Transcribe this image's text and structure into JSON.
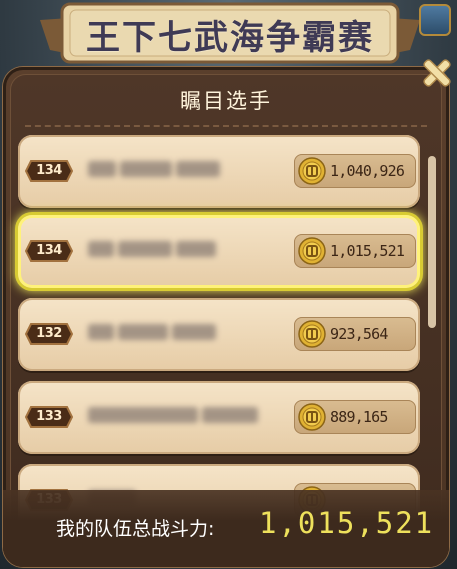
{
  "event_title": "王下七武海争霸赛",
  "panel": {
    "title": "瞩目选手"
  },
  "players": [
    {
      "level": "134",
      "power": "1,040,926",
      "selected": false,
      "name_blocks": 3
    },
    {
      "level": "134",
      "power": "1,015,521",
      "selected": true,
      "name_blocks": 3
    },
    {
      "level": "132",
      "power": "923,564",
      "selected": false,
      "name_blocks": 3
    },
    {
      "level": "133",
      "power": "889,165",
      "selected": false,
      "name_blocks": 2
    },
    {
      "level": "133",
      "power": "",
      "selected": false,
      "name_blocks": 1
    }
  ],
  "footer": {
    "label": "我的队伍总战斗力:",
    "value": "1,015,521"
  },
  "colors": {
    "panel_bg": "#4a3323",
    "row_bg": "#f0dcbc",
    "highlight": "#eee15c",
    "power_pill": "#cfb084"
  },
  "icons": {
    "level": "level-badge-icon",
    "power": "coin-icon",
    "close": "close-cross-icon"
  }
}
